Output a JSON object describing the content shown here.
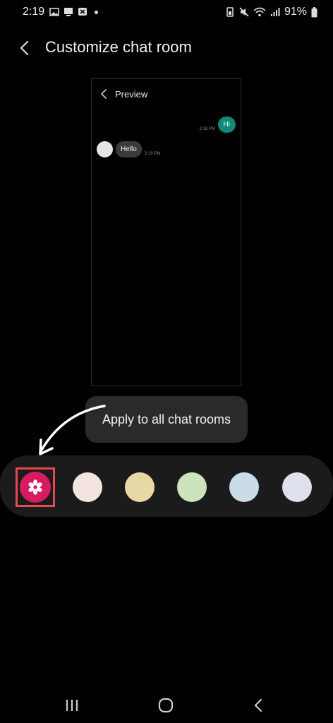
{
  "status_bar": {
    "time": "2:19",
    "battery": "91%"
  },
  "header": {
    "title": "Customize chat room"
  },
  "preview": {
    "title": "Preview",
    "outgoing_message": "Hi",
    "outgoing_time": "2:19 PM",
    "incoming_message": "Hello",
    "incoming_time": "2:19 PM"
  },
  "tooltip": {
    "text": "Apply to all chat rooms"
  },
  "palette": {
    "swatches": [
      {
        "name": "custom",
        "color": "#d81b60",
        "selected": true
      },
      {
        "name": "pink",
        "color": "#f3e4e2"
      },
      {
        "name": "yellow",
        "color": "#e8d8a5"
      },
      {
        "name": "green",
        "color": "#cde3bd"
      },
      {
        "name": "blue",
        "color": "#c9dce8"
      },
      {
        "name": "lavender",
        "color": "#dfe0ee"
      }
    ]
  },
  "colors": {
    "accent_teal": "#0f8a7a",
    "selection_red": "#e5484d"
  }
}
